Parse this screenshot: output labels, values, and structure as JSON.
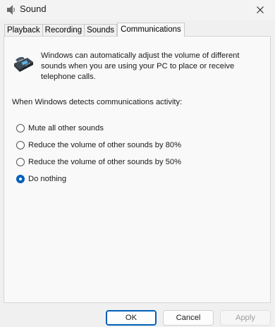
{
  "window": {
    "title": "Sound",
    "close_icon": "close-icon",
    "app_icon": "speaker-icon"
  },
  "tabs": [
    {
      "label": "Playback",
      "active": false
    },
    {
      "label": "Recording",
      "active": false
    },
    {
      "label": "Sounds",
      "active": false
    },
    {
      "label": "Communications",
      "active": true
    }
  ],
  "communications": {
    "icon": "telephone-icon",
    "description": "Windows can automatically adjust the volume of different sounds when you are using your PC to place or receive telephone calls.",
    "prompt": "When Windows detects communications activity:",
    "options": [
      {
        "label": "Mute all other sounds",
        "selected": false
      },
      {
        "label": "Reduce the volume of other sounds by 80%",
        "selected": false
      },
      {
        "label": "Reduce the volume of other sounds by 50%",
        "selected": false
      },
      {
        "label": "Do nothing",
        "selected": true
      }
    ]
  },
  "buttons": {
    "ok": "OK",
    "cancel": "Cancel",
    "apply": "Apply",
    "apply_enabled": false
  },
  "colors": {
    "accent": "#005fb8"
  }
}
